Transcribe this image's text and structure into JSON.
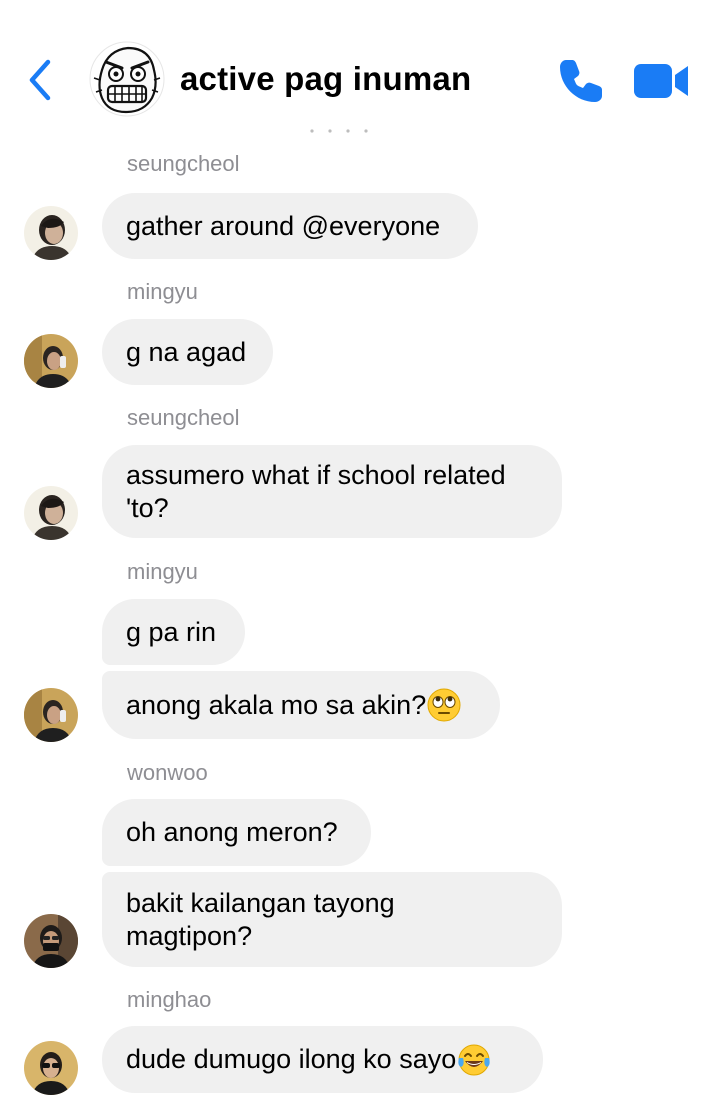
{
  "header": {
    "title": "active pag inuman",
    "accent_color": "#1a7cf5",
    "back_icon": "chevron-left-icon",
    "call_icon": "phone-icon",
    "video_icon": "video-camera-icon",
    "group_photo": "rage-face-meme"
  },
  "messages": [
    {
      "sender": "seungcheol",
      "text": "gather around @everyone"
    },
    {
      "sender": "mingyu",
      "text": "g na agad"
    },
    {
      "sender": "seungcheol",
      "text": "assumero what if school related\n'to?"
    },
    {
      "sender": "mingyu",
      "text": "g pa rin"
    },
    {
      "sender": "",
      "text": "anong akala mo sa akin?",
      "emoji": "eye-roll-emoji"
    },
    {
      "sender": "wonwoo",
      "text": "oh anong meron?"
    },
    {
      "sender": "",
      "text": "bakit kailangan tayong\nmagtipon?"
    },
    {
      "sender": "minghao",
      "text": "dude dumugo ilong ko sayo",
      "emoji": "tears-of-joy-emoji"
    }
  ],
  "colors": {
    "bubble_bg": "#f0f0f0",
    "sender_text": "#8e8e93",
    "message_text": "#000000"
  }
}
